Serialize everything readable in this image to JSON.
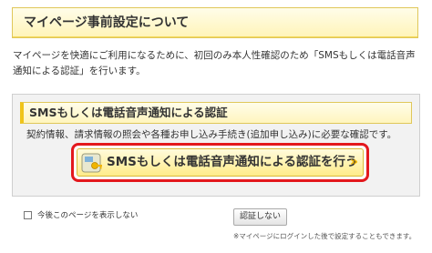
{
  "header": {
    "title": "マイページ事前設定について"
  },
  "intro": {
    "text": "マイページを快適にご利用になるために、初回のみ本人性確認のため「SMSもしくは電話音声通知による認証」を行います。"
  },
  "panel": {
    "title": "SMSもしくは電話音声通知による認証",
    "description": "契約情報、請求情報の照会や各種お申し込み手続き(追加申し込み)に必要な確認です。",
    "auth_button_label": "SMSもしくは電話音声通知による認証を行う",
    "auth_button_arrow": "»",
    "auth_button_icon": "phone-key-icon"
  },
  "footer": {
    "hide_checkbox_label": "今後このページを表示しない",
    "hide_checkbox_checked": false,
    "no_auth_button_label": "認証しない",
    "note": "※マイページにログインした後で設定することもできます。"
  },
  "colors": {
    "header_bg": "#fff4b8",
    "header_border": "#e0c75a",
    "panel_bg": "#f2f2f2",
    "accent_yellow": "#f0c419",
    "highlight_red": "#e3181d",
    "text": "#333333"
  }
}
